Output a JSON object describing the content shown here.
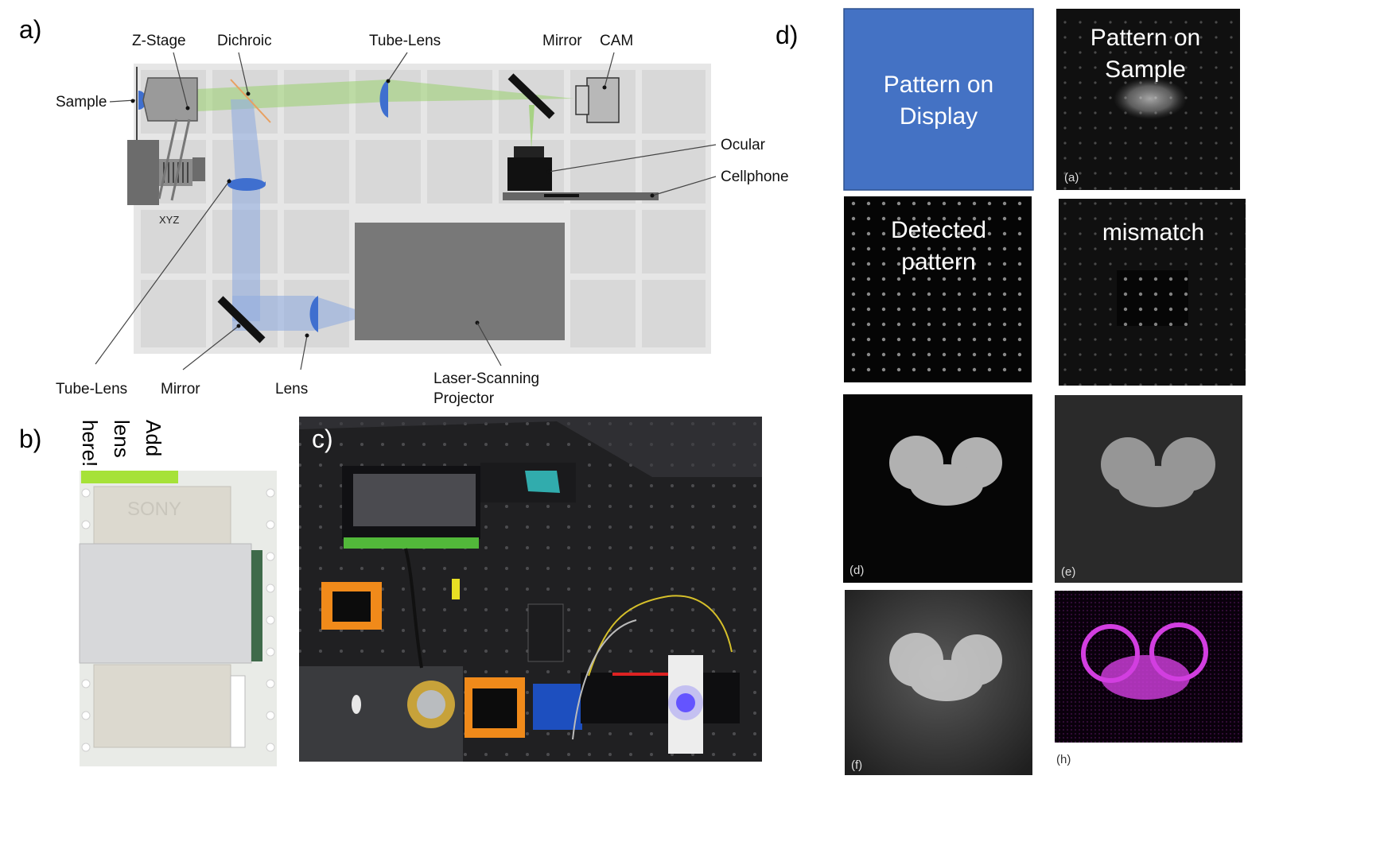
{
  "panel_labels": {
    "a": "a)",
    "b": "b)",
    "c": "c)",
    "d": "d)"
  },
  "optics": {
    "z_stage": "Z-Stage",
    "dichroic": "Dichroic",
    "tube_lens_top": "Tube-Lens",
    "mirror_top": "Mirror",
    "cam": "CAM",
    "sample": "Sample",
    "ocular": "Ocular",
    "cellphone": "Cellphone",
    "xyz": "XYZ",
    "tube_lens_bottom": "Tube-Lens",
    "mirror_bottom": "Mirror",
    "lens": "Lens",
    "projector_line1": "Laser-Scanning",
    "projector_line2": "Projector"
  },
  "board": {
    "vertical_lines": [
      "Add",
      "lens",
      "here!"
    ],
    "brand": "SONY"
  },
  "grid_tiles": {
    "display_line1": "Pattern on",
    "display_line2": "Display",
    "sample_line1": "Pattern on",
    "sample_line2": "Sample",
    "detected_line1": "Detected",
    "detected_line2": "pattern",
    "mismatch": "mismatch",
    "tag_a": "(a)",
    "tag_d": "(d)",
    "tag_e": "(e)",
    "tag_f": "(f)",
    "tag_h": "(h)"
  },
  "colors": {
    "display_blue": "#4472c4",
    "green_beam": "#9bd16f",
    "blue_beam": "#93aee0",
    "lens_blue": "#3f6fcf",
    "magenta": "#d23ee0"
  }
}
